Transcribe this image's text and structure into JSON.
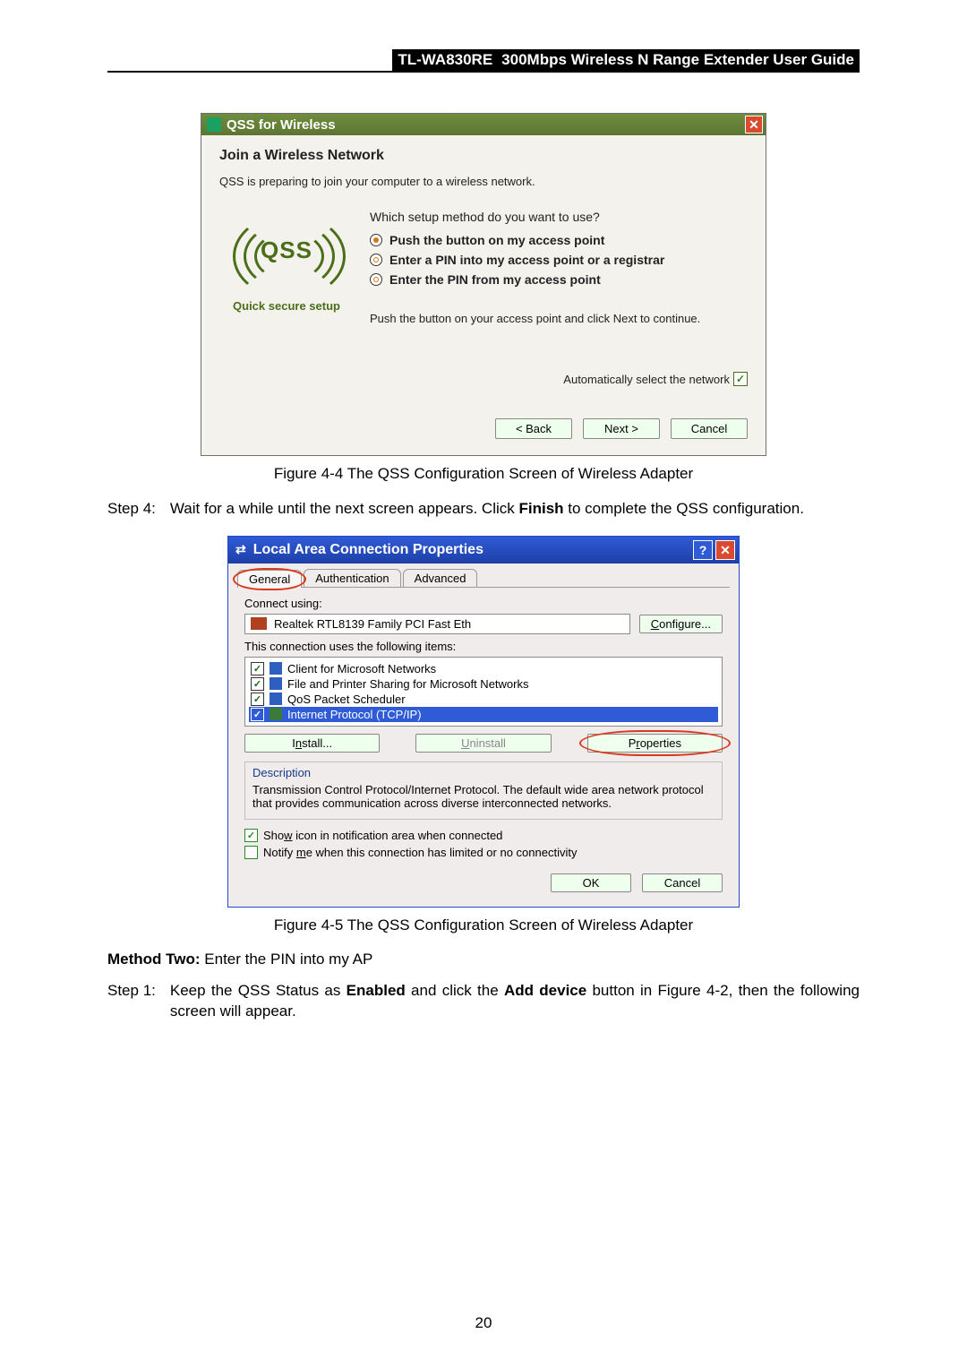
{
  "header": {
    "model": "TL-WA830RE",
    "title": "300Mbps Wireless N Range Extender User Guide"
  },
  "page_number": "20",
  "qss": {
    "window_title": "QSS for Wireless",
    "heading": "Join a Wireless Network",
    "subheading": "QSS is preparing to join your computer to a wireless network.",
    "question": "Which setup method do you want to use?",
    "options": {
      "o1": "Push the button on my access point",
      "o2": "Enter a PIN into my access point or a registrar",
      "o3": "Enter the PIN from my access point"
    },
    "instruction": "Push the button on your access point and click Next to continue.",
    "auto_label": "Automatically select the network",
    "logo_label": "Quick secure setup",
    "logo_text": "QSS",
    "back": "< Back",
    "next": "Next >",
    "cancel": "Cancel"
  },
  "caption44": "Figure 4-4 The QSS Configuration Screen of Wireless Adapter",
  "step4": {
    "label": "Step 4:",
    "text_a": "Wait for a while until the next screen appears. Click ",
    "bold": "Finish",
    "text_b": " to complete the QSS configuration."
  },
  "lac": {
    "title": "Local Area Connection Properties",
    "tabs": {
      "general": "General",
      "auth": "Authentication",
      "adv": "Advanced"
    },
    "connect_label": "Connect using:",
    "nic": "Realtek RTL8139 Family PCI Fast Eth",
    "configure": "Configure...",
    "configure_u": "C",
    "items_label": "This connection uses the following items:",
    "items": {
      "i1": "Client for Microsoft Networks",
      "i2": "File and Printer Sharing for Microsoft Networks",
      "i3": "QoS Packet Scheduler",
      "i4": "Internet Protocol (TCP/IP)"
    },
    "install": "Install...",
    "install_u": "n",
    "uninstall": "Uninstall",
    "uninstall_u": "U",
    "properties": "Properties",
    "properties_u": "r",
    "desc_label": "Description",
    "desc": "Transmission Control Protocol/Internet Protocol. The default wide area network protocol that provides communication across diverse interconnected networks.",
    "chk1_a": "Sho",
    "chk1_u": "w",
    "chk1_b": " icon in notification area when connected",
    "chk2_a": "Notify ",
    "chk2_u": "m",
    "chk2_b": "e when this connection has limited or no connectivity",
    "ok": "OK",
    "cancel": "Cancel"
  },
  "caption45": "Figure 4-5 The QSS Configuration Screen of Wireless Adapter",
  "method2": {
    "label": "Method Two:",
    "text": " Enter the PIN into my AP"
  },
  "step1": {
    "label": "Step 1:",
    "text_a": "Keep the QSS Status as ",
    "b1": "Enabled",
    "text_b": " and click the ",
    "b2": "Add device",
    "text_c": " button in Figure 4-2, then the following screen will appear."
  }
}
